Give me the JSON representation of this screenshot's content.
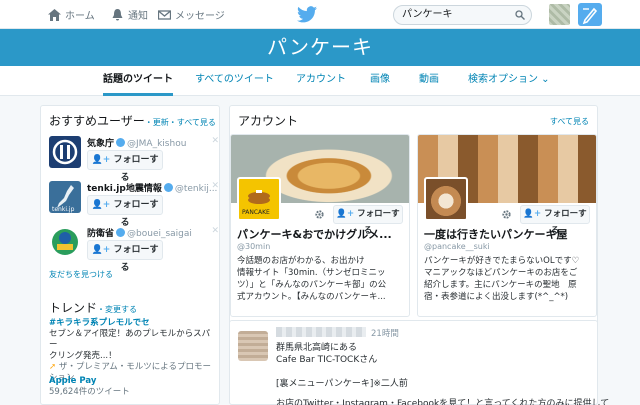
{
  "nav": {
    "home": "ホーム",
    "notifications": "通知",
    "messages": "メッセージ"
  },
  "search": {
    "value": "パンケーキ"
  },
  "banner": {
    "title": "パンケーキ"
  },
  "tabs": [
    "話題のツイート",
    "すべてのツイート",
    "アカウント",
    "画像",
    "動画",
    "検索オプション"
  ],
  "who_to_follow": {
    "title": "おすすめユーザー",
    "refresh": "・更新",
    "view_all": "・すべて見る",
    "users": [
      {
        "name": "気象庁",
        "handle": "@JMA_kishou",
        "follow": "フォローする"
      },
      {
        "name": "tenki.jp地震情報",
        "handle": "@tenkij...",
        "follow": "フォローする"
      },
      {
        "name": "防衛省",
        "handle": "@bouei_saigai",
        "follow": "フォローする"
      }
    ],
    "find_friends": "友だちを見つける"
  },
  "trends": {
    "title": "トレンド",
    "change": "・変更する",
    "items": [
      {
        "name": "#キラキラ系プレモルでセ",
        "desc1": "セブン＆アイ限定！あのプレモルからスパー",
        "desc2": "クリング発売...！",
        "promo": "ザ・プレミアム・モルツによるプロモーション"
      },
      {
        "name": "Apple Pay",
        "desc1": "59,624件のツイート"
      }
    ]
  },
  "accounts": {
    "title": "アカウント",
    "view_all": "すべて見る",
    "cards": [
      {
        "name": "パンケーキ&おでかけグルメ...",
        "handle": "@30min",
        "follow": "フォローする",
        "avatar_text": "PANCAKE",
        "bio": [
          "今話題のお店がわかる、お出かけ",
          "情報サイト「30min.（サンゼロミニッ",
          "ツ）」と「みんなのパンケーキ部」の公",
          "式アカウント。【みんなのパンケーキ..."
        ]
      },
      {
        "name": "一度は行きたいパンケーキ屋",
        "handle": "@pancake__suki",
        "follow": "フォローする",
        "bio": [
          "パンケーキが好きでたまらないOLです♡",
          "マニアックなほどパンケーキのお店をご",
          "紹介します。主にパンケーキの聖地　原",
          "宿・表参道によく出没します(*^_^*)"
        ]
      }
    ]
  },
  "tweet": {
    "time": "21時間",
    "lines": [
      "群馬県北高崎にある",
      "Cafe Bar TIC-TOCKさん",
      "",
      "[裏メニューパンケーキ]※二人前",
      "",
      "お店のTwitter・Instagram・Facebookを見て！と言ってくれた方のみに提供して"
    ]
  },
  "colors": {
    "accent": "#2b98c8",
    "link": "#0084b4",
    "twitter_blue": "#55acee"
  }
}
